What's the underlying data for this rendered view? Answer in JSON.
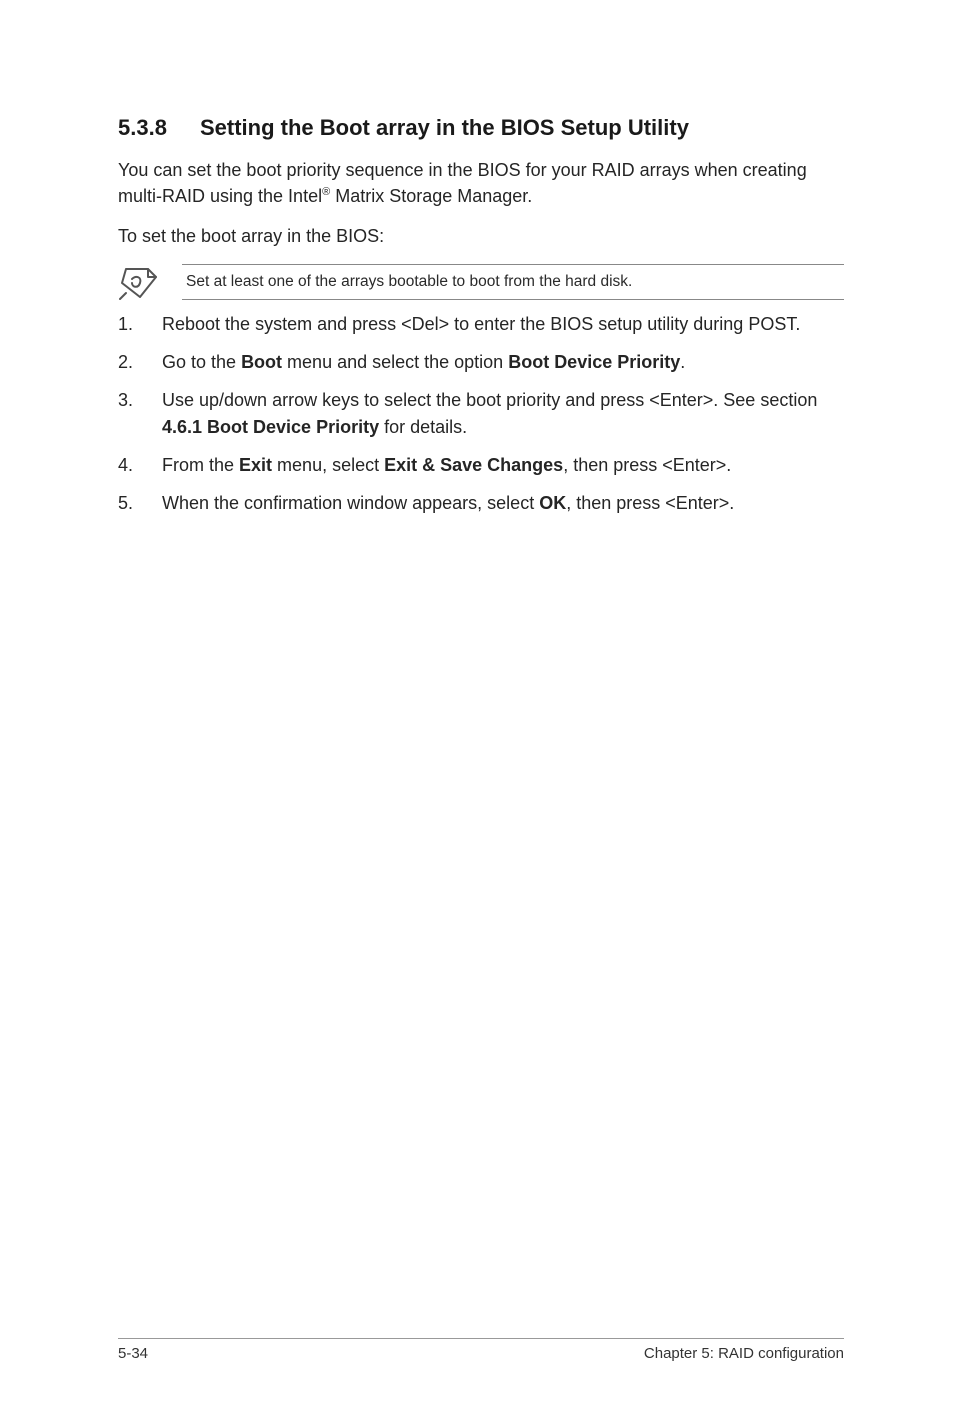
{
  "heading": {
    "num": "5.3.8",
    "title": "Setting the Boot array in the BIOS Setup Utility"
  },
  "para1_pre": "You can set the boot priority sequence in the BIOS for your RAID arrays when creating multi-RAID using the Intel",
  "para1_sup": "®",
  "para1_post": " Matrix Storage Manager.",
  "para2": "To set the boot array in the BIOS:",
  "note": "Set at least one of the arrays bootable to boot from the hard disk.",
  "steps": {
    "s1": "Reboot the system and press <Del> to enter the BIOS setup utility during POST.",
    "s2_a": "Go to the ",
    "s2_b": "Boot",
    "s2_c": " menu and select the option ",
    "s2_d": "Boot Device Priority",
    "s2_e": ".",
    "s3_a": "Use up/down arrow keys to select the boot priority and press <Enter>. See section ",
    "s3_b": "4.6.1 Boot Device Priority",
    "s3_c": " for details.",
    "s4_a": "From the ",
    "s4_b": "Exit",
    "s4_c": " menu, select ",
    "s4_d": "Exit & Save Changes",
    "s4_e": ", then press <Enter>.",
    "s5_a": "When the confirmation window appears, select ",
    "s5_b": "OK",
    "s5_c": ", then press <Enter>."
  },
  "footer": {
    "page": "5-34",
    "chapter": "Chapter 5: RAID configuration"
  }
}
